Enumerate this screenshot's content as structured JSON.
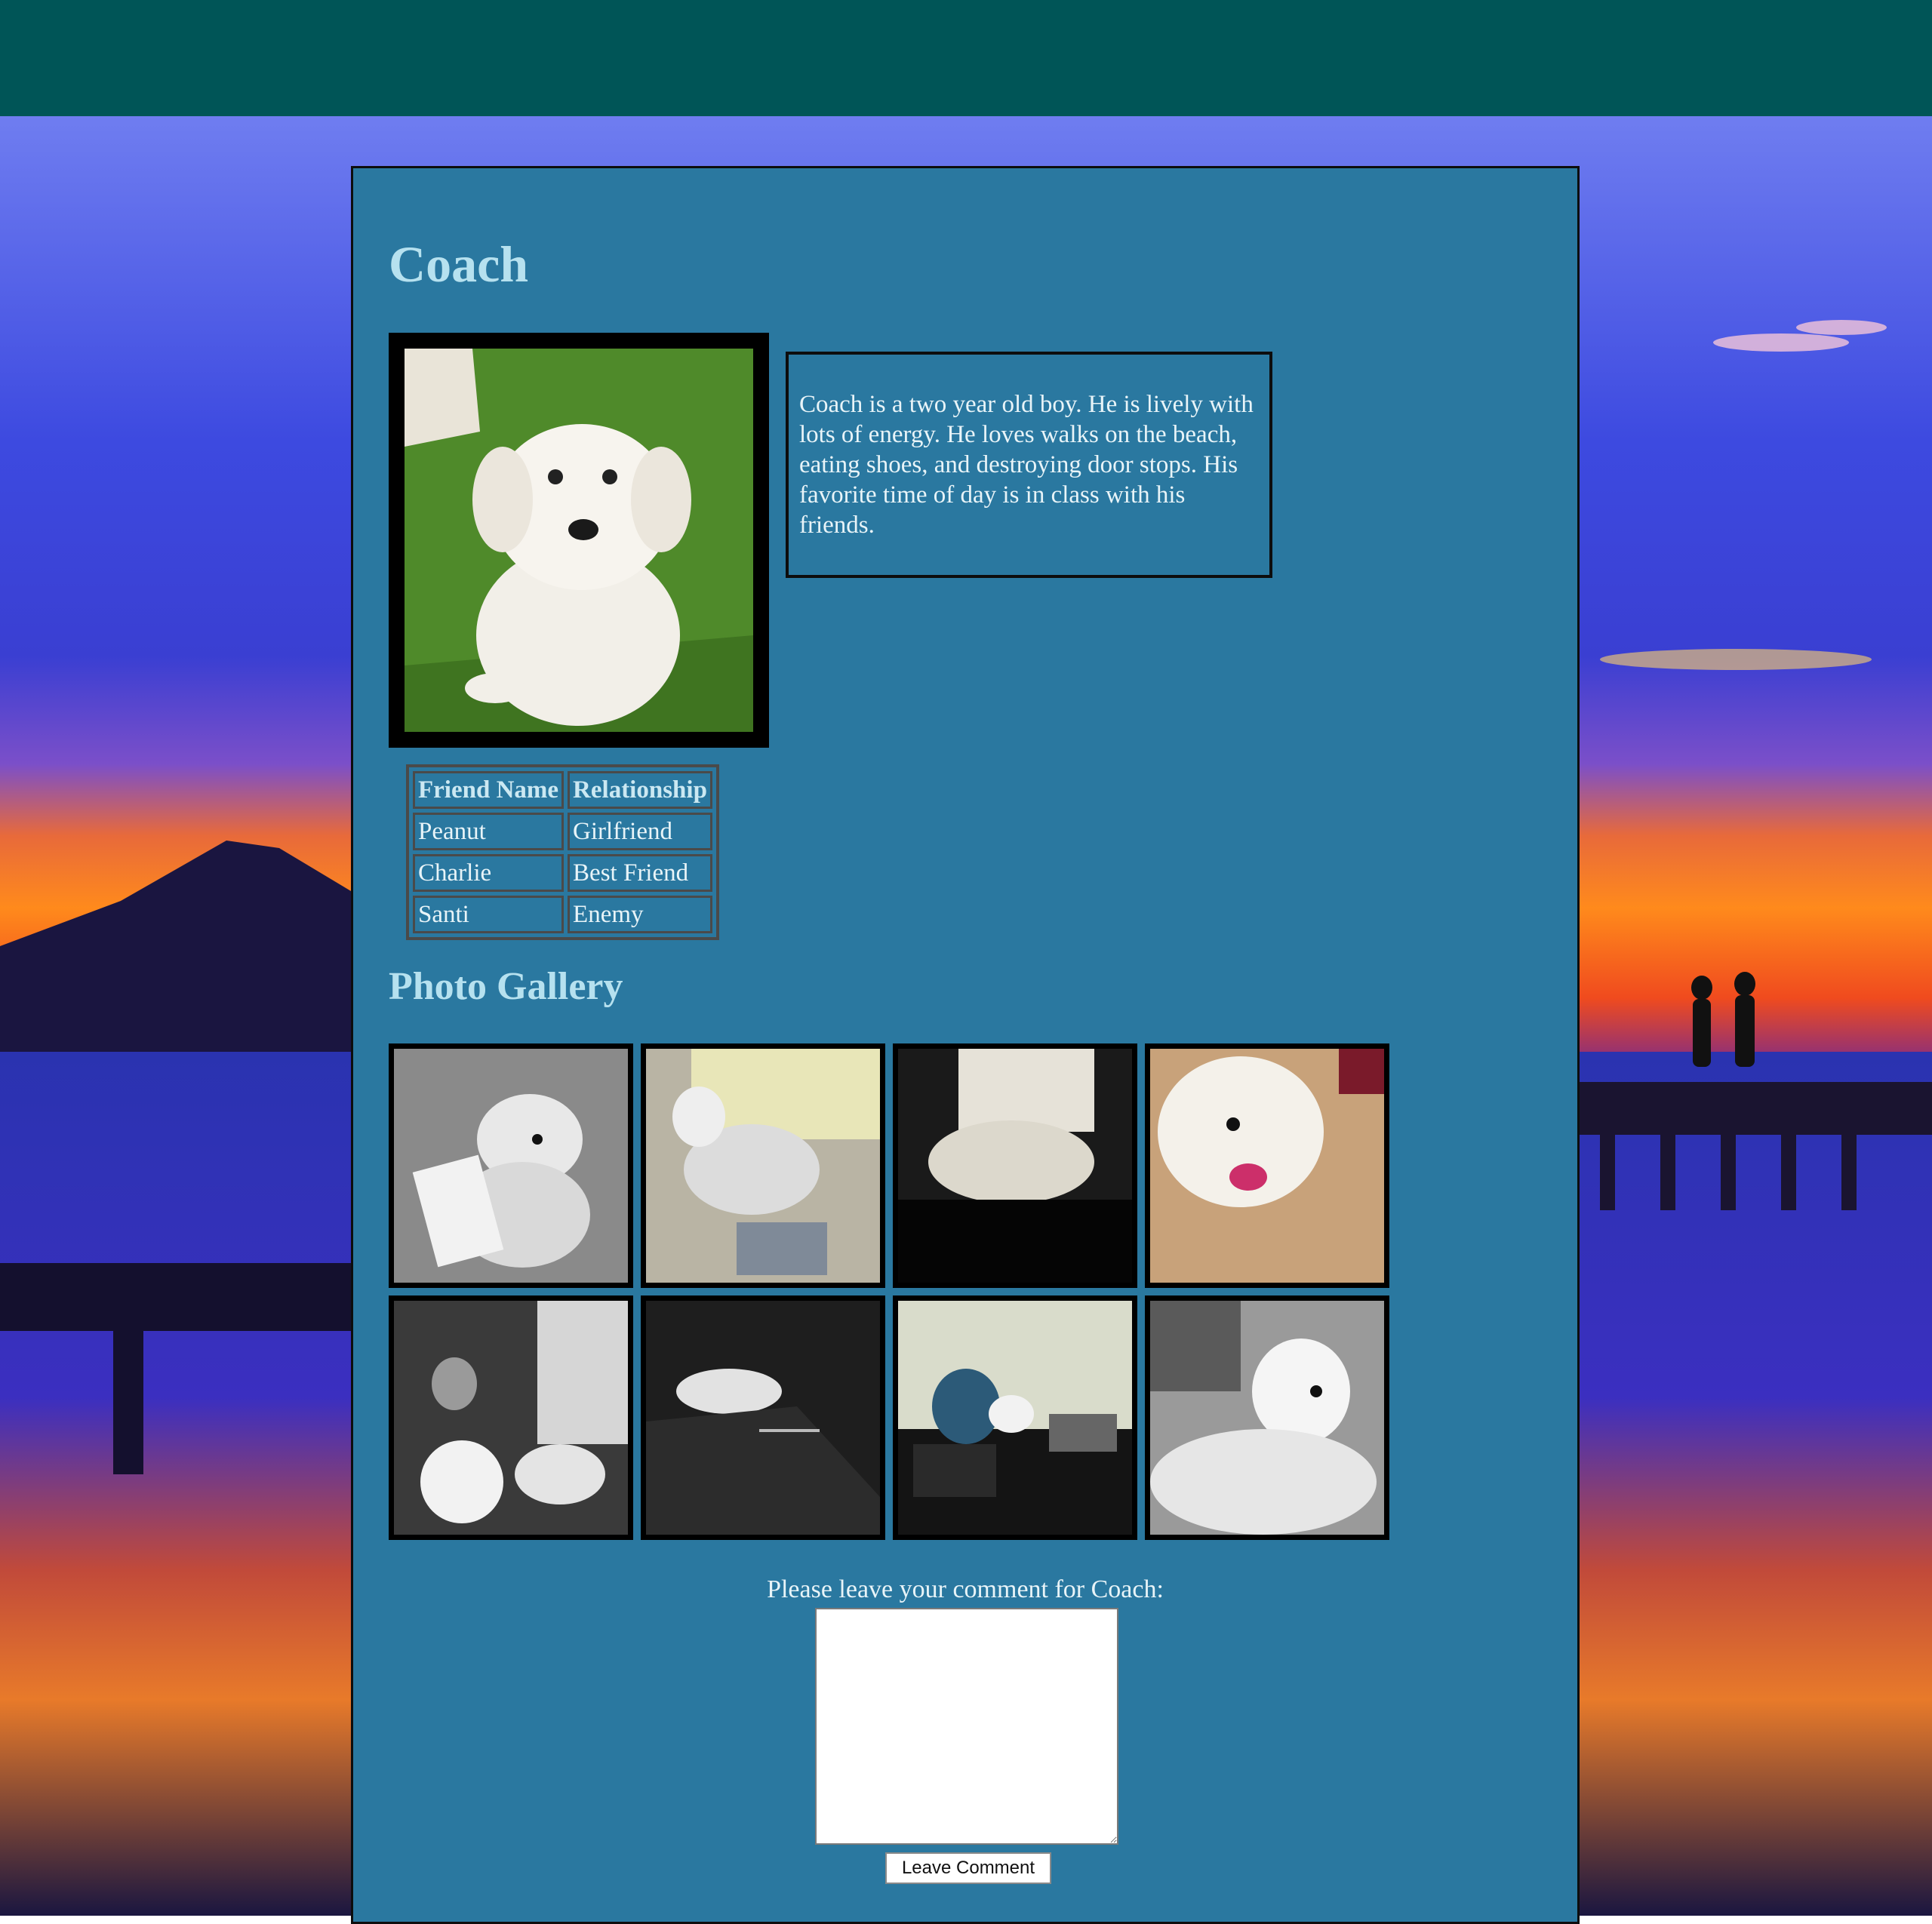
{
  "pet": {
    "name": "Coach",
    "bio": "Coach is a two year old boy. He is lively with lots of energy. He loves walks on the beach, eating shoes, and destroying door stops. His favorite time of day is in class with his friends."
  },
  "friends": {
    "headers": [
      "Friend Name",
      "Relationship"
    ],
    "rows": [
      [
        "Peanut",
        "Girlfriend"
      ],
      [
        "Charlie",
        "Best Friend"
      ],
      [
        "Santi",
        "Enemy"
      ]
    ]
  },
  "gallery": {
    "title": "Photo Gallery",
    "photos": [
      {
        "name": "gallery-photo-1"
      },
      {
        "name": "gallery-photo-2"
      },
      {
        "name": "gallery-photo-3"
      },
      {
        "name": "gallery-photo-4"
      },
      {
        "name": "gallery-photo-5"
      },
      {
        "name": "gallery-photo-6"
      },
      {
        "name": "gallery-photo-7"
      },
      {
        "name": "gallery-photo-8"
      }
    ]
  },
  "comment": {
    "label": "Please leave your comment for Coach:",
    "value": "",
    "button_label": "Leave Comment"
  },
  "colors": {
    "topbar": "#005557",
    "panel": "#2a78a0",
    "heading": "#b6e1ef",
    "text": "#e8f4f8"
  }
}
